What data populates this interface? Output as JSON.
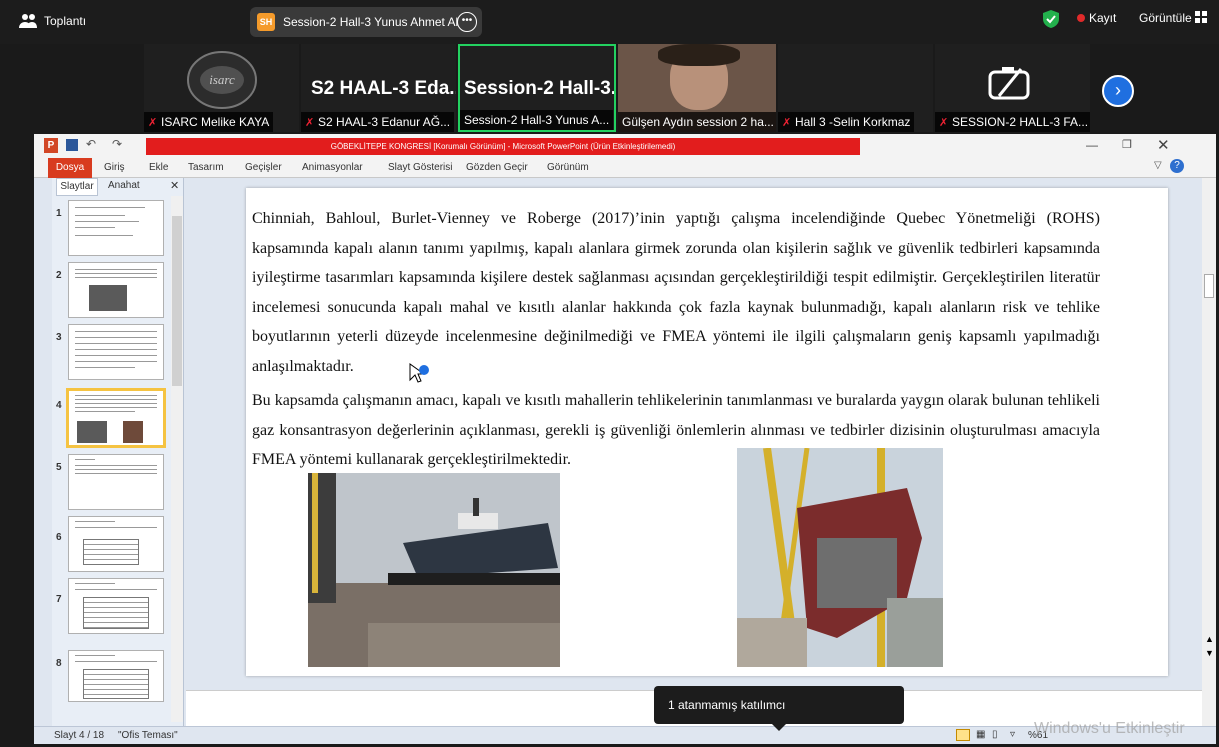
{
  "zoom": {
    "app_title": "Toplantı",
    "share_badge": "SH",
    "share_title": "Session-2 Hall-3 Yunus Ahmet Al",
    "recording_label": "Kayıt",
    "view_label": "Görüntüle",
    "record_color": "#e02a2a",
    "accent": "#1f6fe0"
  },
  "participants": [
    {
      "name": "ISARC Melike KAYA",
      "muted": true,
      "logo_text": "isarc"
    },
    {
      "name": "S2 HAAL-3 Edanur AĞ...",
      "muted": true,
      "big": "S2 HAAL-3 Eda..."
    },
    {
      "name": "Session-2 Hall-3 Yunus A...",
      "muted": false,
      "big": "Session-2 Hall-3...",
      "active": true
    },
    {
      "name": "Gülşen Aydın session 2 ha...",
      "muted": true
    },
    {
      "name": "Hall 3 -Selin Korkmaz",
      "muted": true
    },
    {
      "name": "SESSION-2 HALL-3 FA...",
      "muted": true
    }
  ],
  "powerpoint": {
    "window_title": "GÖBEKLİTEPE KONGRESİ [Korumalı Görünüm] - Microsoft PowerPoint (Ürün Etkinleştirilemedi)",
    "tabs": [
      "Dosya",
      "Giriş",
      "Ekle",
      "Tasarım",
      "Geçişler",
      "Animasyonlar",
      "Slayt Gösterisi",
      "Gözden Geçir",
      "Görünüm"
    ],
    "pane_tabs": [
      "Slaytlar",
      "Anahat"
    ],
    "thumb_numbers": [
      "1",
      "2",
      "3",
      "4",
      "5",
      "6",
      "7",
      "8"
    ],
    "status_slide": "Slayt 4 / 18",
    "status_theme": "\"Ofis Teması\"",
    "zoom_percent": "%61"
  },
  "slide": {
    "paragraph1": "Chinniah, Bahloul, Burlet-Vienney ve Roberge (2017)’inin yaptığı çalışma incelendiğinde Quebec Yönetmeliği (ROHS) kapsamında kapalı alanın tanımı yapılmış, kapalı alanlara girmek zorunda olan kişilerin sağlık ve güvenlik tedbirleri kapsamında iyileştirme tasarımları kapsamında kişilere destek sağlanması açısından gerçekleştirildiği tespit edilmiştir. Gerçekleştirilen literatür incelemesi sonucunda kapalı mahal ve kısıtlı alanlar hakkında çok fazla kaynak bulunmadığı, kapalı alanların risk ve tehlike boyutlarının yeterli düzeyde incelenmesine değinilmediği ve FMEA yöntemi ile ilgili çalışmaların geniş kapsamlı yapılmadığı anlaşılmaktadır.",
    "paragraph2": "Bu kapsamda çalışmanın amacı, kapalı ve kısıtlı mahallerin tehlikelerinin tanımlanması ve buralarda yaygın olarak bulunan tehlikeli gaz konsantrasyon değerlerinin açıklanması, gerekli iş güvenliği önlemlerin alınması ve tedbirler dizisinin oluşturulması amacıyla FMEA yöntemi kullanarak gerçekleştirilmektedir."
  },
  "tooltip": "1 atanmamış katılımcı",
  "watermark": "Windows'u Etkinleştir"
}
